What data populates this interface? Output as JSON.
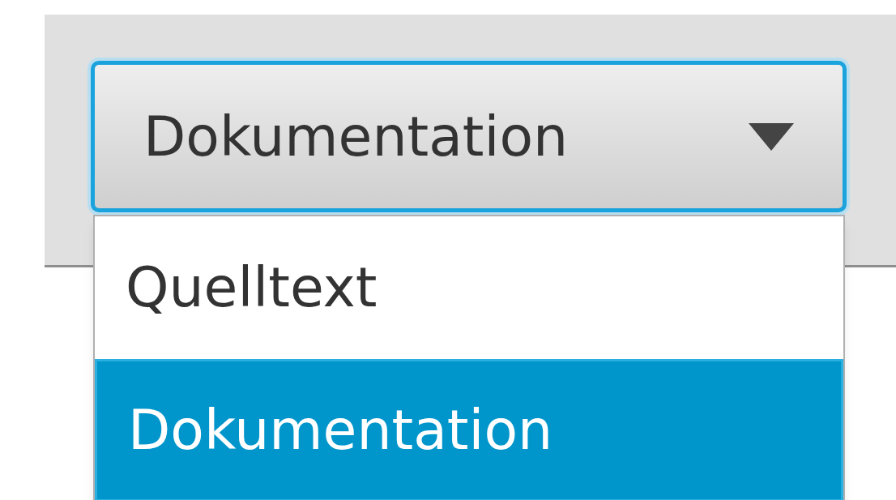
{
  "combo": {
    "value": "Dokumentation",
    "expanded": true
  },
  "options": [
    {
      "label": "Quelltext",
      "selected": false
    },
    {
      "label": "Dokumentation",
      "selected": true
    }
  ]
}
